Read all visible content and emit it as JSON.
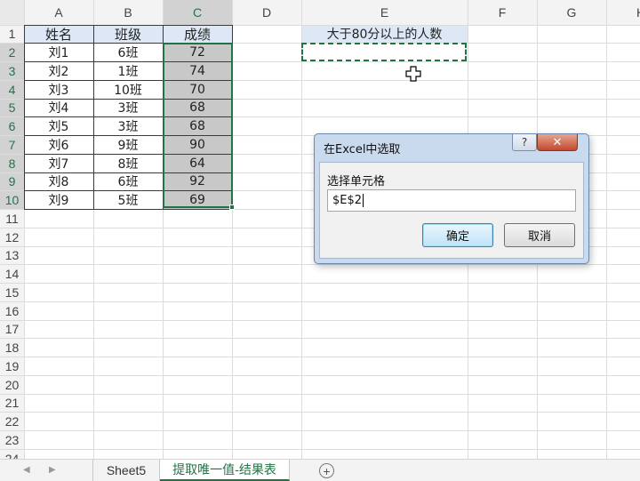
{
  "columns": [
    "A",
    "B",
    "C",
    "D",
    "E",
    "F",
    "G",
    "H"
  ],
  "rows": [
    "1",
    "2",
    "3",
    "4",
    "5",
    "6",
    "7",
    "8",
    "9",
    "10",
    "11",
    "12",
    "13",
    "14",
    "15",
    "16",
    "17",
    "18",
    "19",
    "20",
    "21",
    "22",
    "23",
    "24"
  ],
  "headers": {
    "name": "姓名",
    "class": "班级",
    "score": "成绩"
  },
  "records": [
    {
      "name": "刘1",
      "class": "6班",
      "score": "72"
    },
    {
      "name": "刘2",
      "class": "1班",
      "score": "74"
    },
    {
      "name": "刘3",
      "class": "10班",
      "score": "70"
    },
    {
      "name": "刘4",
      "class": "3班",
      "score": "68"
    },
    {
      "name": "刘5",
      "class": "3班",
      "score": "68"
    },
    {
      "name": "刘6",
      "class": "9班",
      "score": "90"
    },
    {
      "name": "刘7",
      "class": "8班",
      "score": "64"
    },
    {
      "name": "刘8",
      "class": "6班",
      "score": "92"
    },
    {
      "name": "刘9",
      "class": "5班",
      "score": "69"
    }
  ],
  "e1_text": "大于80分以上的人数",
  "dialog": {
    "title": "在Excel中选取",
    "help": "?",
    "close": "✕",
    "label": "选择单元格",
    "value": "$E$2",
    "ok": "确定",
    "cancel": "取消"
  },
  "sheet_tabs": [
    "Sheet5",
    "提取唯一值-结果表"
  ],
  "add_sheet": "+",
  "nav_prev": "◀",
  "nav_next": "▶",
  "colors": {
    "accent": "#217346",
    "header_fill": "#dde7f5",
    "score_fill": "#c8c8c8"
  }
}
